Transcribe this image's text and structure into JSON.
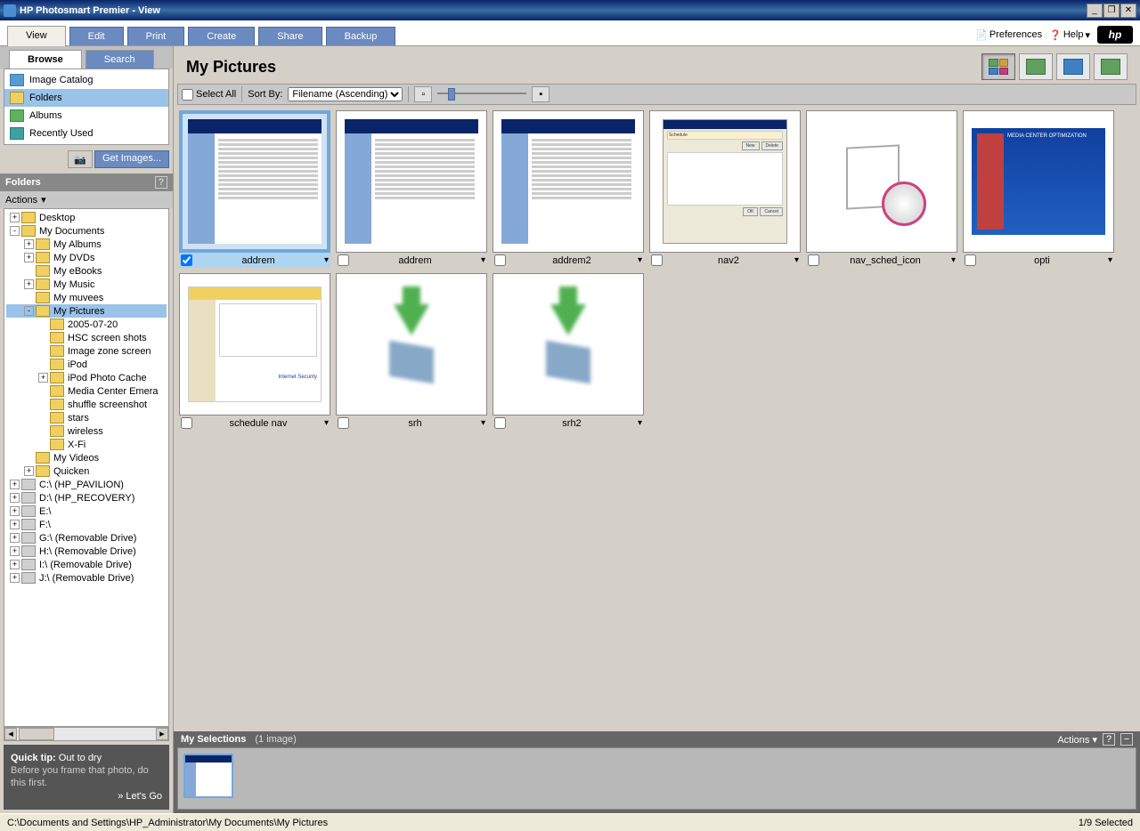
{
  "titlebar": {
    "title": "HP Photosmart Premier - View"
  },
  "tabs": {
    "items": [
      {
        "label": "View",
        "active": true
      },
      {
        "label": "Edit"
      },
      {
        "label": "Print"
      },
      {
        "label": "Create"
      },
      {
        "label": "Share"
      },
      {
        "label": "Backup"
      }
    ],
    "preferences": "Preferences",
    "help": "Help"
  },
  "left": {
    "tabs": {
      "browse": "Browse",
      "search": "Search"
    },
    "cats": {
      "catalog": "Image Catalog",
      "folders": "Folders",
      "albums": "Albums",
      "recent": "Recently Used"
    },
    "getimages": "Get Images...",
    "folders_hdr": "Folders",
    "actions": "Actions",
    "tree": [
      {
        "level": 0,
        "exp": "+",
        "icon": "folder",
        "label": "Desktop"
      },
      {
        "level": 0,
        "exp": "-",
        "icon": "folder",
        "label": "My Documents"
      },
      {
        "level": 1,
        "exp": "+",
        "icon": "folder",
        "label": "My Albums"
      },
      {
        "level": 1,
        "exp": "+",
        "icon": "folder",
        "label": "My DVDs"
      },
      {
        "level": 1,
        "exp": "",
        "icon": "folder",
        "label": "My eBooks"
      },
      {
        "level": 1,
        "exp": "+",
        "icon": "folder",
        "label": "My Music"
      },
      {
        "level": 1,
        "exp": "",
        "icon": "folder",
        "label": "My muvees"
      },
      {
        "level": 1,
        "exp": "-",
        "icon": "folder",
        "label": "My Pictures",
        "selected": true
      },
      {
        "level": 2,
        "exp": "",
        "icon": "folder",
        "label": "2005-07-20"
      },
      {
        "level": 2,
        "exp": "",
        "icon": "folder",
        "label": "HSC screen shots"
      },
      {
        "level": 2,
        "exp": "",
        "icon": "folder",
        "label": "Image zone screen"
      },
      {
        "level": 2,
        "exp": "",
        "icon": "folder",
        "label": "iPod"
      },
      {
        "level": 2,
        "exp": "+",
        "icon": "folder",
        "label": "iPod Photo Cache"
      },
      {
        "level": 2,
        "exp": "",
        "icon": "folder",
        "label": "Media Center Emera"
      },
      {
        "level": 2,
        "exp": "",
        "icon": "folder",
        "label": "shuffle screenshot"
      },
      {
        "level": 2,
        "exp": "",
        "icon": "folder",
        "label": "stars"
      },
      {
        "level": 2,
        "exp": "",
        "icon": "folder",
        "label": "wireless"
      },
      {
        "level": 2,
        "exp": "",
        "icon": "folder",
        "label": "X-Fi"
      },
      {
        "level": 1,
        "exp": "",
        "icon": "folder",
        "label": "My Videos"
      },
      {
        "level": 1,
        "exp": "+",
        "icon": "folder",
        "label": "Quicken"
      },
      {
        "level": 0,
        "exp": "+",
        "icon": "drive",
        "label": "C:\\ (HP_PAVILION)"
      },
      {
        "level": 0,
        "exp": "+",
        "icon": "drive",
        "label": "D:\\ (HP_RECOVERY)"
      },
      {
        "level": 0,
        "exp": "+",
        "icon": "drive",
        "label": "E:\\"
      },
      {
        "level": 0,
        "exp": "+",
        "icon": "drive",
        "label": "F:\\"
      },
      {
        "level": 0,
        "exp": "+",
        "icon": "drive",
        "label": "G:\\ (Removable Drive)"
      },
      {
        "level": 0,
        "exp": "+",
        "icon": "drive",
        "label": "H:\\ (Removable Drive)"
      },
      {
        "level": 0,
        "exp": "+",
        "icon": "drive",
        "label": "I:\\ (Removable Drive)"
      },
      {
        "level": 0,
        "exp": "+",
        "icon": "drive",
        "label": "J:\\ (Removable Drive)"
      }
    ],
    "tip": {
      "title": "Quick tip:",
      "subject": "Out to dry",
      "body": "Before you frame that photo, do this first.",
      "go": "» Let's Go"
    }
  },
  "main": {
    "heading": "My Pictures",
    "select_all": "Select All",
    "sort_by": "Sort By:",
    "sort_value": "Filename (Ascending)",
    "thumbs": [
      {
        "name": "addrem",
        "kind": "ss",
        "selected": true,
        "checked": true
      },
      {
        "name": "addrem",
        "kind": "ss"
      },
      {
        "name": "addrem2",
        "kind": "ss"
      },
      {
        "name": "nav2",
        "kind": "panel"
      },
      {
        "name": "nav_sched_icon",
        "kind": "iconclock"
      },
      {
        "name": "opti",
        "kind": "blue"
      },
      {
        "name": "schedule nav",
        "kind": "norton"
      },
      {
        "name": "srh",
        "kind": "install"
      },
      {
        "name": "srh2",
        "kind": "install"
      }
    ]
  },
  "tray": {
    "title": "My Selections",
    "count": "(1 image)",
    "actions": "Actions"
  },
  "status": {
    "path": "C:\\Documents and Settings\\HP_Administrator\\My Documents\\My Pictures",
    "selected": "1/9 Selected"
  }
}
